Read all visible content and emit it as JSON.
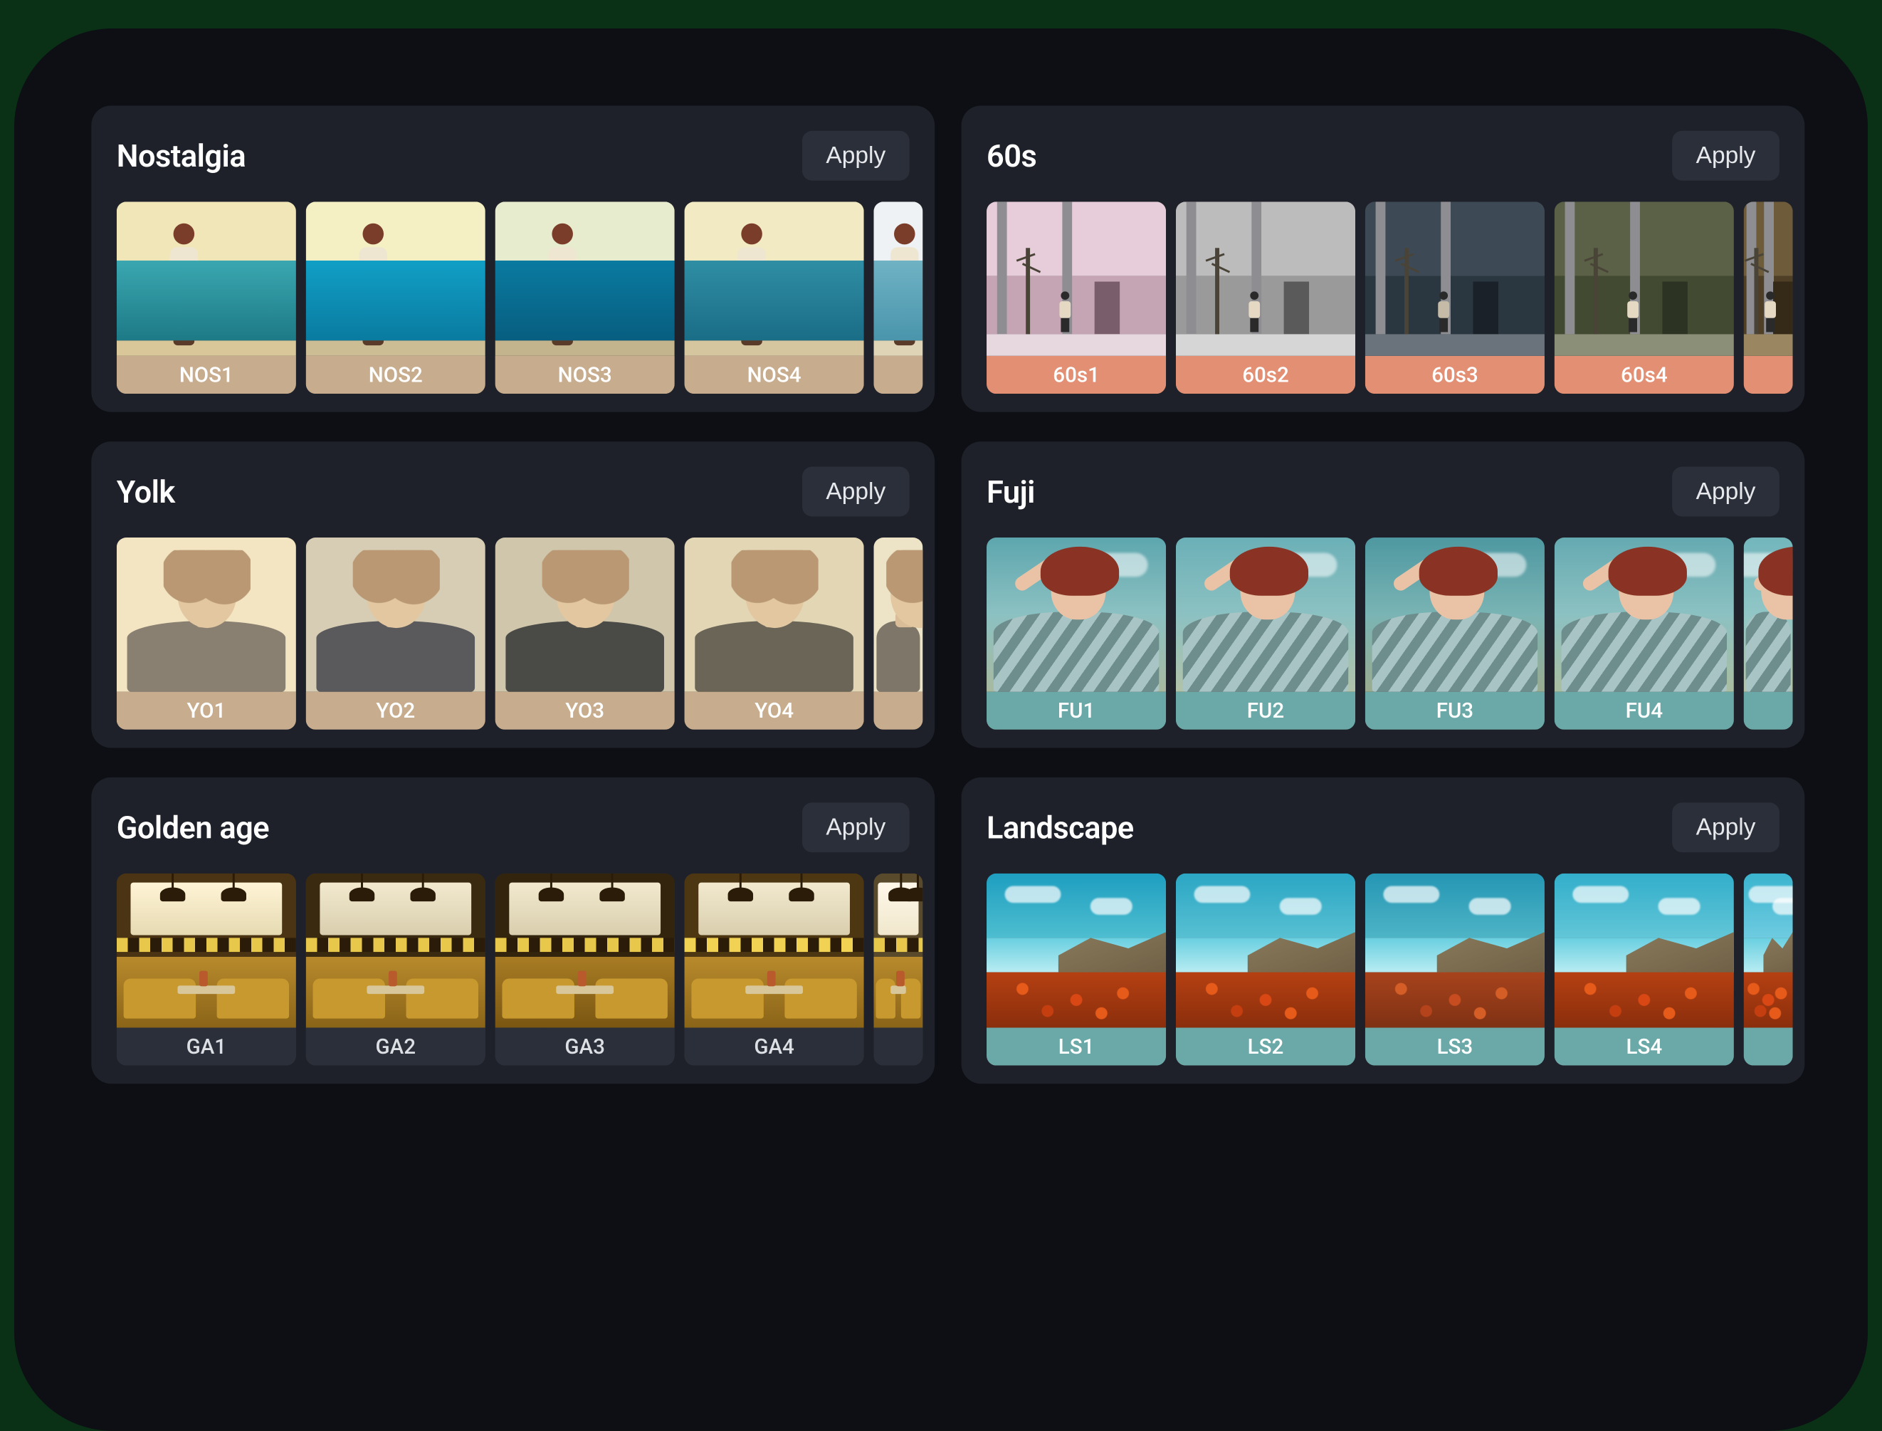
{
  "apply_label": "Apply",
  "label_colors": {
    "tan": "#c7ad8e",
    "salmon": "#e38f73",
    "teal": "#6ba9a8",
    "dark": "#2b2f39"
  },
  "thumb_width_main": 256,
  "thumb_width_peek": 70,
  "packs": [
    {
      "id": "nostalgia",
      "title": "Nostalgia",
      "label_color": "tan",
      "scene_class": "nostalgia-base",
      "scene_html": "<div class='shore'></div><div class='person'><div class='head'></div><div class='torso'></div><div class='legs'></div></div>",
      "presets": [
        {
          "label": "NOS1",
          "variant": "nos-v1"
        },
        {
          "label": "NOS2",
          "variant": "nos-v2"
        },
        {
          "label": "NOS3",
          "variant": "nos-v3"
        },
        {
          "label": "NOS4",
          "variant": "nos-v4"
        },
        {
          "label": "",
          "variant": "nos-v5",
          "peek": true
        }
      ]
    },
    {
      "id": "sixties",
      "title": "60s",
      "label_color": "salmon",
      "scene_class": "sixties-base",
      "scene_html": "<div class='bldg'><div class='upper'></div><div class='lower'></div><div class='pilL'></div><div class='pilR'></div><div class='door'></div></div><div class='ground'></div><div class='tree'></div><div class='walker'><div class='h'></div><div class='b'></div><div class='l'></div></div>",
      "presets": [
        {
          "label": "60s1",
          "variant": "s60-v1"
        },
        {
          "label": "60s2",
          "variant": "s60-v2"
        },
        {
          "label": "60s3",
          "variant": "s60-v3"
        },
        {
          "label": "60s4",
          "variant": "s60-v4"
        },
        {
          "label": "",
          "variant": "s60-v5",
          "peek": true
        }
      ]
    },
    {
      "id": "yolk",
      "title": "Yolk",
      "label_color": "tan",
      "scene_class": "yolk-base",
      "scene_html": "<div class='bg'></div><div class='jacket'></div><div class='neck'></div><div class='head'></div><div class='hair'></div>",
      "presets": [
        {
          "label": "YO1",
          "variant": "yo-v1"
        },
        {
          "label": "YO2",
          "variant": "yo-v2"
        },
        {
          "label": "YO3",
          "variant": "yo-v3"
        },
        {
          "label": "YO4",
          "variant": "yo-v4"
        },
        {
          "label": "",
          "variant": "yo-v5",
          "peek": true
        }
      ]
    },
    {
      "id": "fuji",
      "title": "Fuji",
      "label_color": "teal",
      "scene_class": "fuji-base",
      "scene_html": "<div class='sky'></div><div class='cloud'></div><div class='shirt'></div><div class='arm'></div><div class='head'></div><div class='hair'></div>",
      "presets": [
        {
          "label": "FU1",
          "variant": "fu-v1"
        },
        {
          "label": "FU2",
          "variant": "fu-v2"
        },
        {
          "label": "FU3",
          "variant": "fu-v3"
        },
        {
          "label": "FU4",
          "variant": "fu-v4"
        },
        {
          "label": "",
          "variant": "fu-v5",
          "peek": true
        }
      ]
    },
    {
      "id": "golden-age",
      "title": "Golden age",
      "label_color": "dark",
      "scene_class": "golden-base",
      "scene_html": "<div class='wall'></div><div class='win'></div><div class='check'></div><div class='lamp l1'></div><div class='lamp l2'></div><div class='booth'></div><div class='seat sl'></div><div class='seat sr'></div><div class='table'></div><div class='jar'></div>",
      "presets": [
        {
          "label": "GA1",
          "variant": "ga-v1"
        },
        {
          "label": "GA2",
          "variant": "ga-v2"
        },
        {
          "label": "GA3",
          "variant": "ga-v3"
        },
        {
          "label": "GA4",
          "variant": "ga-v4"
        },
        {
          "label": "",
          "variant": "ga-v5",
          "peek": true
        }
      ]
    },
    {
      "id": "landscape",
      "title": "Landscape",
      "label_color": "teal",
      "scene_class": "land-base",
      "scene_html": "<div class='sky'></div><div class='cloud'></div><div class='cloud c2'></div><div class='sea'></div><div class='cliff'></div><div class='flowers'></div>",
      "presets": [
        {
          "label": "LS1",
          "variant": "ls-v1"
        },
        {
          "label": "LS2",
          "variant": "ls-v2"
        },
        {
          "label": "LS3",
          "variant": "ls-v3"
        },
        {
          "label": "LS4",
          "variant": "ls-v4"
        },
        {
          "label": "",
          "variant": "ls-v5",
          "peek": true
        }
      ]
    }
  ]
}
